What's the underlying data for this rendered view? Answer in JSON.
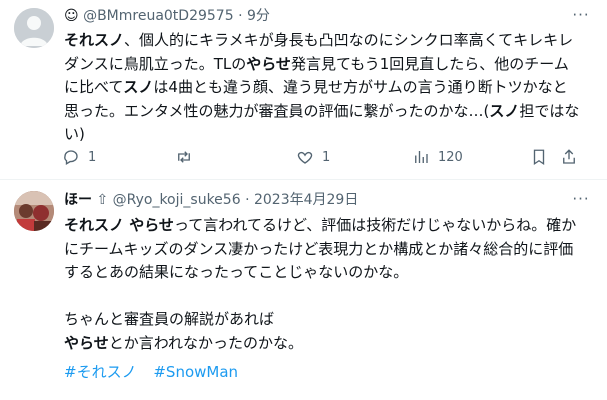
{
  "tweet1": {
    "name": "☺",
    "handle": "@BMmreua0tD29575",
    "sep": "·",
    "time": "9分",
    "more": "···",
    "lines": [
      [
        {
          "t": "それスノ",
          "b": true
        },
        {
          "t": "、個人的にキラメキが身長も凸凹なのにシンクロ率高くてキレキレ"
        }
      ],
      [
        {
          "t": "ダンスに鳥肌立った。TLの"
        },
        {
          "t": "やらせ",
          "b": true
        },
        {
          "t": "発言見てもう1回見直したら、他のチーム"
        }
      ],
      [
        {
          "t": "に比べて"
        },
        {
          "t": "スノ",
          "b": true
        },
        {
          "t": "は4曲とも違う顔、違う見せ方がサムの言う通り断トツかなと"
        }
      ],
      [
        {
          "t": "思った。エンタメ性の魅力が審査員の評価に繋がったのかな…("
        },
        {
          "t": "スノ",
          "b": true
        },
        {
          "t": "担ではな"
        }
      ],
      [
        {
          "t": "い)"
        }
      ]
    ],
    "actions": {
      "reply_count": "1",
      "retweet_count": "",
      "like_count": "1",
      "views_count": "120"
    }
  },
  "tweet2": {
    "name": "ほー",
    "name_suffix": "⇧",
    "handle": "@Ryo_koji_suke56",
    "sep": "·",
    "date": "2023年4月29日",
    "more": "···",
    "lines": [
      [
        {
          "t": "それスノ やらせ",
          "b": true
        },
        {
          "t": "って言われてるけど、評価は技術だけじゃないからね。確か"
        }
      ],
      [
        {
          "t": "にチームキッズのダンス凄かったけど表現力とか構成とか諸々総合的に評価"
        }
      ],
      [
        {
          "t": "するとあの結果になったってことじゃないのかな。"
        }
      ],
      [],
      [
        {
          "t": "ちゃんと審査員の解説があれば"
        }
      ],
      [
        {
          "t": "やらせ",
          "b": true
        },
        {
          "t": "とか言われなかったのかな。"
        }
      ]
    ],
    "hashtags": [
      "#それスノ",
      "#SnowMan"
    ]
  },
  "colors": {
    "text": "#0f1419",
    "secondary": "#536471",
    "link": "#1d9bf0",
    "divider": "#eff3f4"
  }
}
